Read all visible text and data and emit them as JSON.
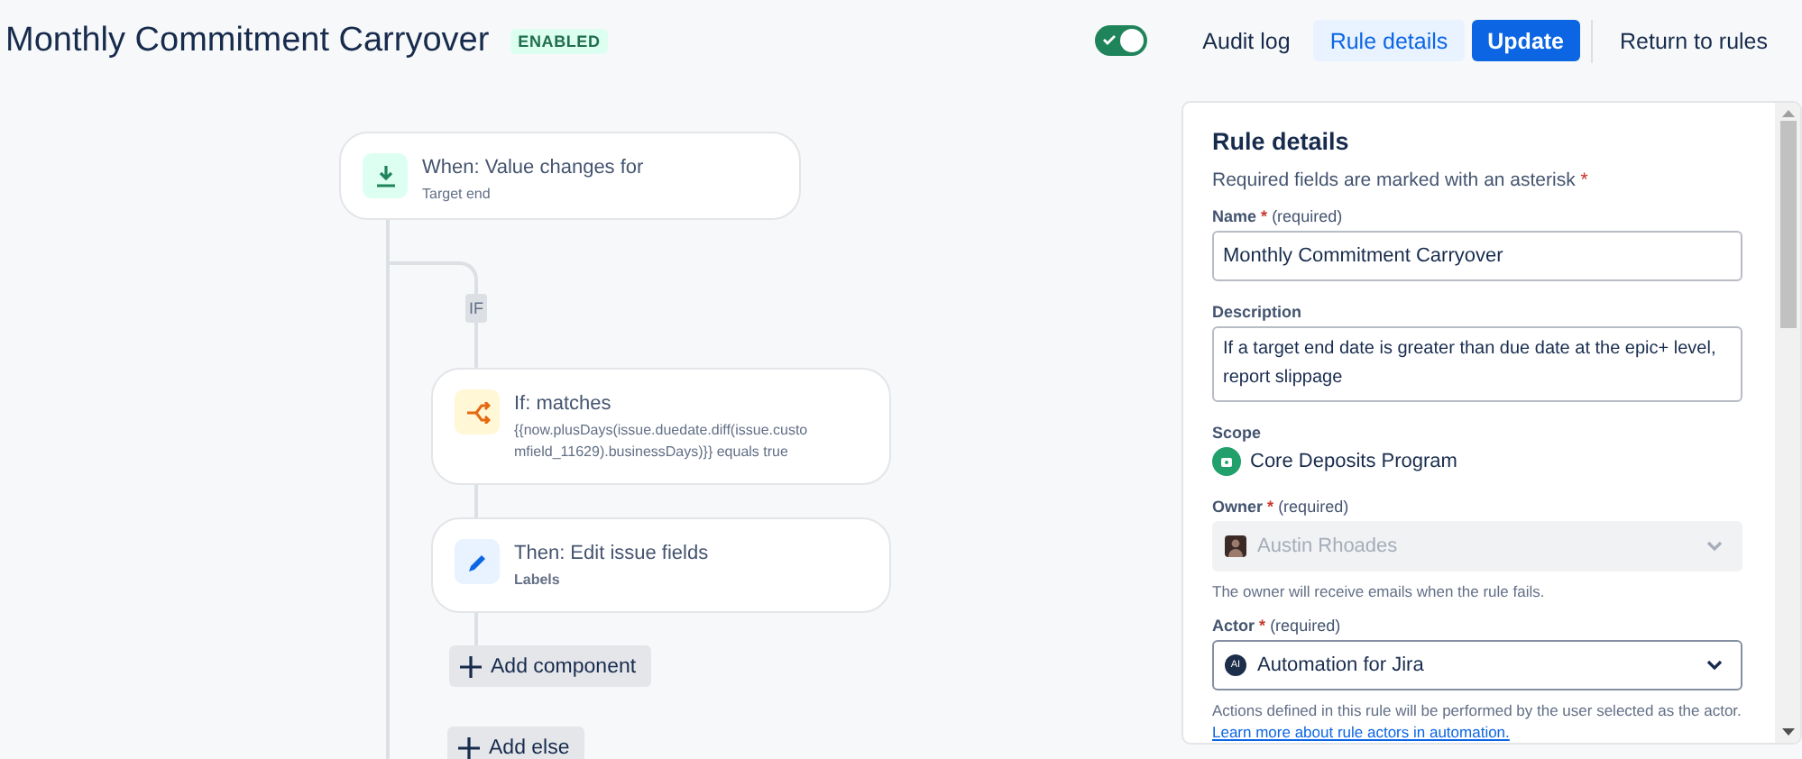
{
  "header": {
    "title": "Monthly Commitment Carryover",
    "status": "ENABLED",
    "toggle": {
      "on": true
    },
    "buttons": [
      {
        "label": "Audit log",
        "kind": "subtle"
      },
      {
        "label": "Rule details",
        "kind": "selected"
      },
      {
        "label": "Update",
        "kind": "primary"
      },
      {
        "label": "Return to rules",
        "kind": "link"
      }
    ]
  },
  "flow": {
    "trigger": {
      "title": "When: Value changes for",
      "subtitle": "Target end"
    },
    "branch_label": "IF",
    "steps": [
      {
        "kind": "condition",
        "title": "If: matches",
        "subtitle": "{{now.plusDays(issue.duedate.diff(issue.customfield_11629).businessDays)}} equals true"
      },
      {
        "kind": "action",
        "title": "Then: Edit issue fields",
        "subtitle": "Labels"
      }
    ],
    "actions": [
      "Add component",
      "Add else"
    ]
  },
  "panel": {
    "title": "Rule details",
    "note": "Required fields are marked with an asterisk",
    "note_mark": "*",
    "fields": [
      {
        "kind": "text",
        "label": "Name",
        "required_mark": "*",
        "hint": "(required)",
        "value": "Monthly Commitment Carryover"
      },
      {
        "kind": "textarea",
        "label": "Description",
        "value": "If a target end date is greater than due date at the epic+ level, report slippage"
      },
      {
        "kind": "scope",
        "label": "Scope",
        "value": "Core Deposits Program"
      },
      {
        "kind": "select",
        "label": "Owner",
        "required_mark": "*",
        "hint": "(required)",
        "value": "Austin Rhoades",
        "disabled": true,
        "help": "The owner will receive emails when the rule fails."
      },
      {
        "kind": "select",
        "label": "Actor",
        "required_mark": "*",
        "hint": "(required)",
        "value": "Automation for Jira",
        "disabled": false,
        "avatar_text": "AI",
        "help": "Actions defined in this rule will be performed by the user selected as the actor.",
        "help_link": "Learn more about rule actors in automation."
      }
    ]
  }
}
